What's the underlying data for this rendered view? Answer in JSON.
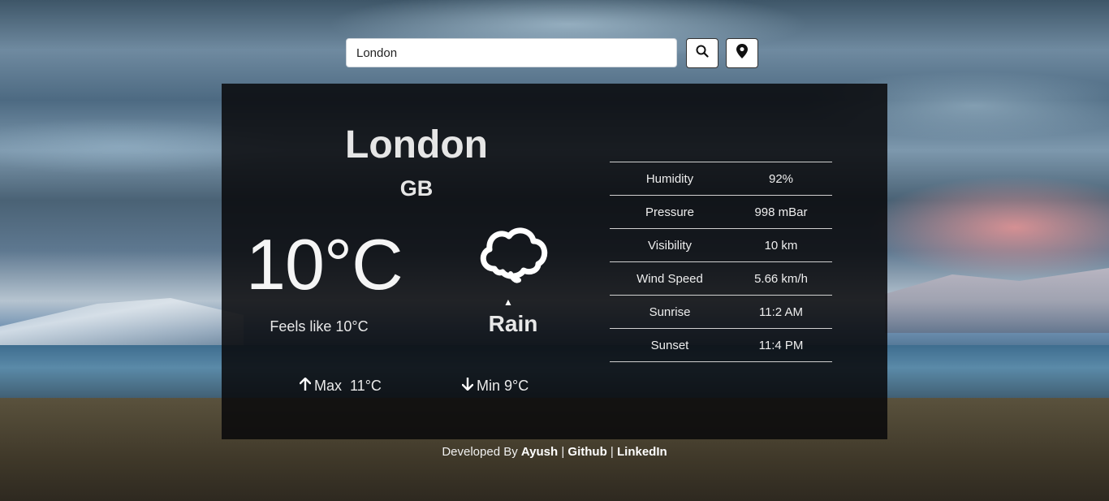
{
  "search": {
    "value": "London"
  },
  "weather": {
    "city": "London",
    "country": "GB",
    "temperature": "10°C",
    "feels_like": "Feels like 10°C",
    "condition": "Rain",
    "max": "Max  11°C",
    "min": "Min 9°C",
    "condition_icon": "cloud-icon"
  },
  "stats": [
    {
      "label": "Humidity",
      "value": "92%"
    },
    {
      "label": "Pressure",
      "value": "998 mBar"
    },
    {
      "label": "Visibility",
      "value": "10 km"
    },
    {
      "label": "Wind Speed",
      "value": "5.66 km/h"
    },
    {
      "label": "Sunrise",
      "value": "11:2 AM"
    },
    {
      "label": "Sunset",
      "value": "11:4 PM"
    }
  ],
  "footer": {
    "prefix": "Developed By ",
    "author": "Ayush",
    "sep1": " | ",
    "github": "Github",
    "sep2": " | ",
    "linkedin": "LinkedIn"
  }
}
